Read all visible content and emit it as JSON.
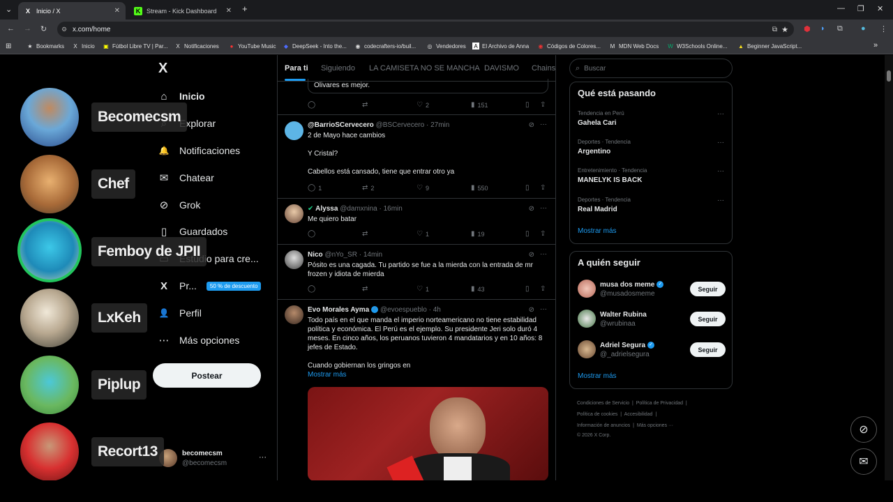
{
  "browser": {
    "tabs": [
      {
        "title": "Inicio / X",
        "favicon": "X"
      },
      {
        "title": "Stream - Kick Dashboard",
        "favicon": "K"
      }
    ],
    "new_tab": "+",
    "address": "x.com/home",
    "bookmarks": [
      {
        "label": "Bookmarks",
        "icon": "★"
      },
      {
        "label": "Inicio",
        "icon": "X"
      },
      {
        "label": "Fútbol Libre TV | Par...",
        "icon": "▣"
      },
      {
        "label": "Notificaciones",
        "icon": "X"
      },
      {
        "label": "YouTube Music",
        "icon": "●"
      },
      {
        "label": "DeepSeek - Into the...",
        "icon": "◆"
      },
      {
        "label": "codecrafters-io/buil...",
        "icon": "◉"
      },
      {
        "label": "Vendedores",
        "icon": "◎"
      },
      {
        "label": "El Archivo de Anna",
        "icon": "A"
      },
      {
        "label": "Códigos de Colores...",
        "icon": "◉"
      },
      {
        "label": "MDN Web Docs",
        "icon": "M"
      },
      {
        "label": "W3Schools Online...",
        "icon": "W"
      },
      {
        "label": "Beginner JavaScript...",
        "icon": "▲"
      }
    ],
    "bookmarks_overflow": "»"
  },
  "nav": {
    "logo": "X",
    "items": [
      {
        "label": "Inicio",
        "icon": "⌂",
        "bold": true
      },
      {
        "label": "Explorar",
        "icon": "⌕"
      },
      {
        "label": "Notificaciones",
        "icon": "🔔"
      },
      {
        "label": "Chatear",
        "icon": "✉"
      },
      {
        "label": "Grok",
        "icon": "⊘"
      },
      {
        "label": "Guardados",
        "icon": "▯"
      },
      {
        "label": "Estudio para cre...",
        "icon": "▭"
      },
      {
        "label": "Pr...",
        "icon": "X"
      },
      {
        "label": "Perfil",
        "icon": "👤"
      },
      {
        "label": "Más opciones",
        "icon": "⋯"
      }
    ],
    "premium_badge": "50 % de descuento",
    "post_button": "Postear",
    "account": {
      "name": "becomecsm",
      "handle": "@becomecsm",
      "menu": "···"
    }
  },
  "feed": {
    "tabs": [
      "Para ti",
      "Siguiendo",
      "LA CAMISETA NO SE MANCHA",
      "DAVISMO",
      "Chainsaw..."
    ],
    "posts": [
      {
        "text": "Olivares es mejor.",
        "quoted": true,
        "stats": {
          "replies": "",
          "reposts": "",
          "likes": "2",
          "views": "151"
        }
      },
      {
        "name": "@BarrioSCervecero",
        "handle": "@BSCervecero",
        "time": "· 27min",
        "lines": [
          "2 de Mayo hace cambios",
          "",
          "Y Cristal?",
          "",
          "Cabellos está cansado, tiene que entrar otro ya"
        ],
        "stats": {
          "replies": "1",
          "reposts": "2",
          "likes": "9",
          "views": "550"
        }
      },
      {
        "name": "Alyssa",
        "handle": "@damxnina",
        "time": "· 16min",
        "lines": [
          "Me quiero batar"
        ],
        "stats": {
          "replies": "",
          "reposts": "",
          "likes": "1",
          "views": "19"
        }
      },
      {
        "name": "Nico",
        "handle": "@nYo_SR",
        "time": "· 14min",
        "lines": [
          "Pósito es una cagada. Tu partido se fue a la mierda con la entrada de mr",
          "frozen y idiota de mierda"
        ],
        "stats": {
          "replies": "",
          "reposts": "",
          "likes": "1",
          "views": "43"
        }
      },
      {
        "name": "Evo Morales Ayma",
        "handle": "@evoespueblo",
        "time": "· 4h",
        "lines": [
          "Todo país en el que manda el imperio norteamericano no tiene estabilidad",
          "política y económica. El Perú es el ejemplo. Su presidente Jeri solo duró 4",
          "meses. En cinco años, los peruanos tuvieron 4 mandatarios y en 10 años: 8",
          "jefes de Estado.",
          "",
          "Cuando gobiernan los gringos en"
        ],
        "show_more": "Mostrar más"
      }
    ]
  },
  "sidebar": {
    "search_placeholder": "Buscar",
    "trends_title": "Qué está pasando",
    "trends": [
      {
        "meta": "Tendencia en Perú",
        "name": "Gahela Cari"
      },
      {
        "meta": "Deportes · Tendencia",
        "name": "Argentino"
      },
      {
        "meta": "Entretenimiento · Tendencia",
        "name": "MANELYK IS BACK"
      },
      {
        "meta": "Deportes · Tendencia",
        "name": "Real Madrid"
      }
    ],
    "trends_more": "Mostrar más",
    "follow_title": "A quién seguir",
    "follow": [
      {
        "name": "musa dos meme",
        "handle": "@musadosmeme",
        "verified": true
      },
      {
        "name": "Walter Rubina",
        "handle": "@wrubinaa",
        "verified": false
      },
      {
        "name": "Adriel Segura",
        "handle": "@_adrielsegura",
        "verified": true
      }
    ],
    "follow_button": "Seguir",
    "follow_more": "Mostrar más",
    "footer": [
      "Condiciones de Servicio",
      "Política de Privacidad",
      "Política de cookies",
      "Accesibilidad",
      "Información de anuncios",
      "Más opciones ···",
      "© 2026 X Corp."
    ]
  },
  "overlay": {
    "viewers": [
      "Becomecsm",
      "Chef",
      "Femboy de JPII",
      "LxKeh",
      "Piplup",
      "Recort13"
    ]
  }
}
